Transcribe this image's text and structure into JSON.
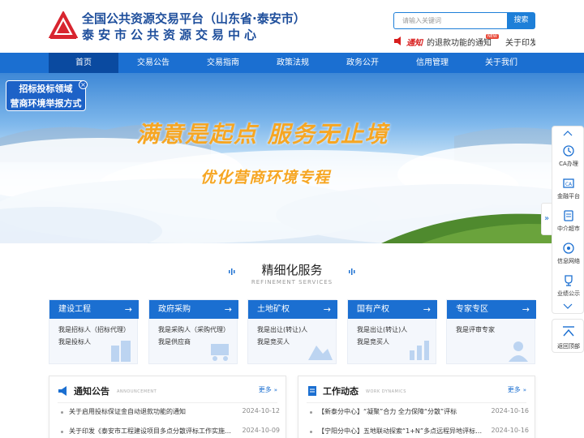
{
  "header": {
    "title": "全国公共资源交易平台（山东省·泰安市）",
    "subtitle": "泰安市公共资源交易中心",
    "search_placeholder": "请输入关键词",
    "search_button": "搜索",
    "notice_tag": "通知",
    "notice_text": "的退款功能的通知",
    "notice_new": "NEW",
    "notice_text2": "关于印发"
  },
  "nav": {
    "items": [
      "首页",
      "交易公告",
      "交易指南",
      "政策法规",
      "政务公开",
      "信用管理",
      "关于我们"
    ]
  },
  "banner": {
    "slogan": "满意是起点  服务无止境",
    "sub": "优化营商环境专程"
  },
  "report_float": {
    "line1": "招标投标领域",
    "line2": "营商环境举报方式",
    "close": "×"
  },
  "side_panel": {
    "items": [
      {
        "label": "CA办理",
        "icon": "ca-icon"
      },
      {
        "label": "金融平台",
        "icon": "finance-icon"
      },
      {
        "label": "中介超市",
        "icon": "mall-icon"
      },
      {
        "label": "信息网络",
        "icon": "network-icon"
      },
      {
        "label": "业绩公示",
        "icon": "trophy-icon"
      }
    ],
    "expand": "»",
    "back_top": "返回顶部"
  },
  "services": {
    "title": "精细化服务",
    "subtitle": "REFINEMENT SERVICES",
    "cards": [
      {
        "title": "建设工程",
        "lines": [
          "我是招标人（招标代理）",
          "我是投标人"
        ]
      },
      {
        "title": "政府采购",
        "lines": [
          "我是采购人（采购代理）",
          "我是供应商"
        ]
      },
      {
        "title": "土地矿权",
        "lines": [
          "我是出让(转让)人",
          "我是竞买人"
        ]
      },
      {
        "title": "国有产权",
        "lines": [
          "我是出让(转让)人",
          "我是竞买人"
        ]
      },
      {
        "title": "专家专区",
        "lines": [
          "我是评审专家"
        ]
      }
    ],
    "arrow": "→"
  },
  "notices": {
    "title": "通知公告",
    "en": "ANNOUNCEMENT",
    "more": "更多",
    "items": [
      {
        "text": "关于启用投标保证金自动退款功能的通知",
        "date": "2024-10-12"
      },
      {
        "text": "关于印发《泰安市工程建设项目多点分散评标工作实施方…",
        "date": "2024-10-09"
      }
    ]
  },
  "work": {
    "title": "工作动态",
    "en": "WORK DYNAMICS",
    "more": "更多",
    "items": [
      {
        "text": "【新泰分中心】“凝聚”合力 全力保障“分散”评标",
        "date": "2024-10-16"
      },
      {
        "text": "【宁阳分中心】五地联动探索“1+N”多点远程异地评标…",
        "date": "2024-10-16"
      }
    ]
  },
  "colors": {
    "primary": "#1b6fd1",
    "title": "#1f4f9c",
    "slogan": "#f6a623",
    "logo": "#d8252f"
  }
}
